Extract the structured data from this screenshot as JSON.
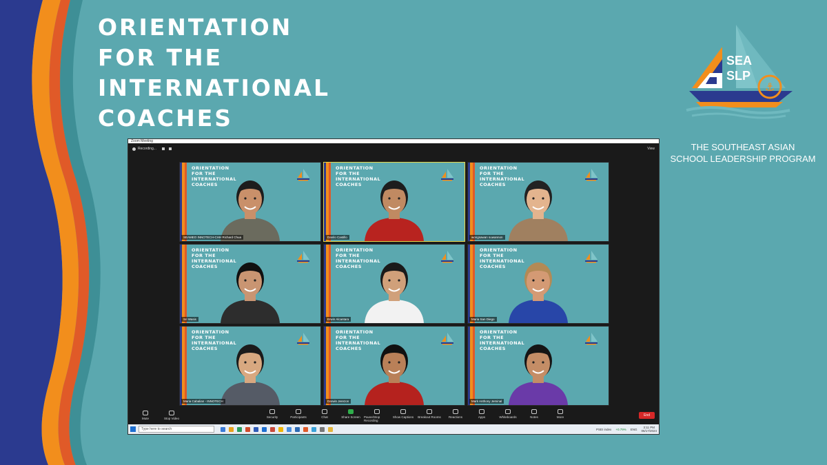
{
  "slide": {
    "title_lines": [
      "ORIENTATION",
      "FOR THE",
      "INTERNATIONAL",
      "COACHES"
    ],
    "logo_text_1": "SEA",
    "logo_text_2": "SLP",
    "tagline_lines": [
      "THE SOUTHEAST ASIAN",
      "SCHOOL LEADERSHIP PROGRAM"
    ],
    "colors": {
      "background": "#5ba8af",
      "navy": "#2b3a8f",
      "orange": "#f28e1c",
      "red_orange": "#e05a28"
    }
  },
  "zoom": {
    "window_title": "Zoom Meeting",
    "recording_label": "Recording...",
    "view_label": "View",
    "tile_title_lines": [
      "ORIENTATION",
      "FOR THE",
      "INTERNATIONAL",
      "COACHES"
    ],
    "participants": [
      {
        "name": "SEAMEO INNOTECH-CHH Richard Chua",
        "shirt": "#6b6b5e",
        "skin": "#c9906a",
        "hair": "#1d1d1d",
        "active": false
      },
      {
        "name": "Danilo Castillo",
        "shirt": "#b8231f",
        "skin": "#c08a62",
        "hair": "#1d1d1d",
        "active": true
      },
      {
        "name": "wongsawan suwannon",
        "shirt": "#a08060",
        "skin": "#e3b48e",
        "hair": "#222222",
        "active": false
      },
      {
        "name": "Sri Wasis",
        "shirt": "#2d2d2d",
        "skin": "#c99572",
        "hair": "#111111",
        "active": false
      },
      {
        "name": "Erwin Alcantara",
        "shirt": "#f2f2f2",
        "skin": "#d0a07a",
        "hair": "#1a1a1a",
        "active": false
      },
      {
        "name": "Maria San Diego",
        "shirt": "#2846a8",
        "skin": "#d49a74",
        "hair": "#b38a55",
        "active": false
      },
      {
        "name": "Maria Cabalian - INNOTECH",
        "shirt": "#555b66",
        "skin": "#d8a880",
        "hair": "#1b1b1b",
        "active": false
      },
      {
        "name": "Darwin Jerezon",
        "shirt": "#b5221e",
        "skin": "#b98058",
        "hair": "#111111",
        "active": false
      },
      {
        "name": "Mark Anthony Jeminal",
        "shirt": "#6a3aa8",
        "skin": "#c48d66",
        "hair": "#151515",
        "active": false
      }
    ],
    "toolbar": {
      "left": [
        {
          "label": "Mute",
          "icon": "microphone-icon"
        },
        {
          "label": "Stop Video",
          "icon": "video-camera-icon"
        }
      ],
      "center": [
        {
          "label": "Security",
          "icon": "shield-icon"
        },
        {
          "label": "Participants",
          "icon": "participants-icon"
        },
        {
          "label": "Chat",
          "icon": "chat-icon"
        },
        {
          "label": "Share Screen",
          "icon": "share-screen-icon"
        },
        {
          "label": "Pause/Stop Recording",
          "icon": "record-icon"
        },
        {
          "label": "Show Captions",
          "icon": "captions-icon"
        },
        {
          "label": "Breakout Rooms",
          "icon": "breakout-rooms-icon"
        },
        {
          "label": "Reactions",
          "icon": "reactions-icon"
        },
        {
          "label": "Apps",
          "icon": "apps-icon"
        },
        {
          "label": "Whiteboards",
          "icon": "whiteboard-icon"
        },
        {
          "label": "Notes",
          "icon": "notes-icon"
        },
        {
          "label": "More",
          "icon": "more-icon"
        }
      ],
      "end_label": "End"
    },
    "taskbar": {
      "search_placeholder": "Type here to search",
      "stock_label": "PSEI index",
      "stock_change": "+0.79%",
      "language": "ENG",
      "time": "3:11 PM",
      "date": "06/17/2024"
    }
  }
}
